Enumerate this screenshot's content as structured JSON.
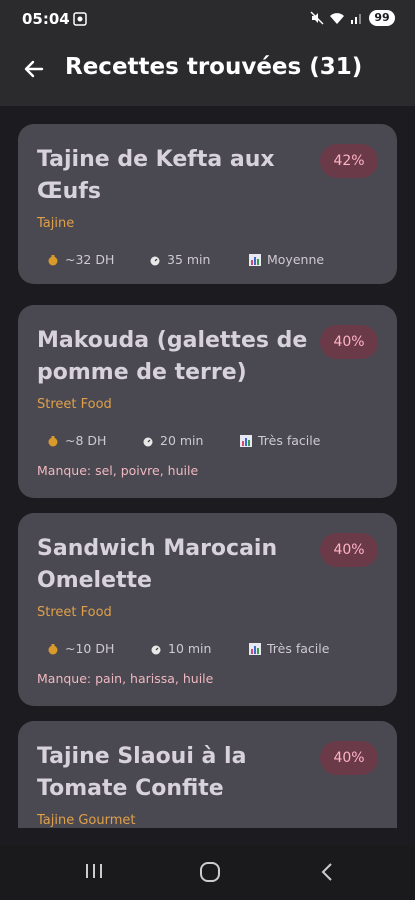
{
  "status": {
    "time": "05:04",
    "battery": "99"
  },
  "header": {
    "title": "Recettes trouvées (31)"
  },
  "recipes": [
    {
      "title": "Tajine de Kefta aux Œufs",
      "match": "42%",
      "category": "Tajine",
      "price": "~32 DH",
      "time": "35 min",
      "difficulty": "Moyenne",
      "missing": ""
    },
    {
      "title": "Makouda (galettes de pomme de terre)",
      "match": "40%",
      "category": "Street Food",
      "price": "~8 DH",
      "time": "20 min",
      "difficulty": "Très facile",
      "missing": "Manque: sel, poivre, huile"
    },
    {
      "title": "Sandwich Marocain Omelette",
      "match": "40%",
      "category": "Street Food",
      "price": "~10 DH",
      "time": "10 min",
      "difficulty": "Très facile",
      "missing": "Manque: pain, harissa, huile"
    },
    {
      "title": "Tajine Slaoui à la Tomate Confite",
      "match": "40%",
      "category": "Tajine Gourmet",
      "price": "",
      "time": "",
      "difficulty": "",
      "missing": ""
    }
  ],
  "colors": {
    "background": "#1c1b1f",
    "card": "#4a4850",
    "badge_bg": "#6a3a48",
    "badge_text": "#ffb4c4",
    "category": "#e0a04a",
    "missing_text": "#f0b8c0"
  },
  "icons": {
    "price": "money-bag-icon",
    "time": "stopwatch-icon",
    "difficulty": "bar-chart-icon"
  }
}
